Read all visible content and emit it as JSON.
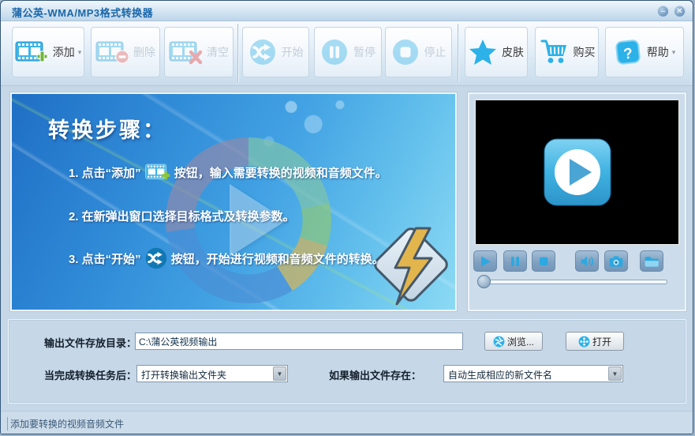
{
  "window": {
    "title": "蒲公英-WMA/MP3格式转换器"
  },
  "titlebar": {
    "minimize_glyph": "–",
    "close_glyph": "✕"
  },
  "toolbar": {
    "buttons": [
      {
        "label": "添加",
        "icon": "film-add-icon",
        "enabled": true,
        "dropdown": true
      },
      {
        "label": "删除",
        "icon": "film-delete-icon",
        "enabled": false,
        "dropdown": false
      },
      {
        "label": "清空",
        "icon": "film-clear-icon",
        "enabled": false,
        "dropdown": false
      },
      {
        "label": "开始",
        "icon": "start-shuffle-icon",
        "enabled": false,
        "dropdown": false
      },
      {
        "label": "暂停",
        "icon": "pause-circle-icon",
        "enabled": false,
        "dropdown": false
      },
      {
        "label": "停止",
        "icon": "stop-circle-icon",
        "enabled": false,
        "dropdown": false
      },
      {
        "label": "皮肤",
        "icon": "skin-star-icon",
        "enabled": true,
        "dropdown": false
      },
      {
        "label": "购买",
        "icon": "buy-cart-icon",
        "enabled": true,
        "dropdown": false
      },
      {
        "label": "帮助",
        "icon": "help-icon",
        "enabled": true,
        "dropdown": true
      }
    ],
    "dropdown_glyph": "▾"
  },
  "instructions": {
    "heading": "转换步骤：",
    "step1_pre": "1. 点击“添加”",
    "step1_post": "按钮，输入需要转换的视频和音频文件。",
    "step2": "2. 在新弹出窗口选择目标格式及转换参数。",
    "step3_pre": "3. 点击“开始”",
    "step3_post": "按钮，开始进行视频和音频文件的转换。"
  },
  "preview": {
    "player_icons": [
      "play-icon",
      "pause-icon",
      "stop-icon",
      "volume-icon",
      "snapshot-icon",
      "folder-icon"
    ],
    "progress": 0
  },
  "settings": {
    "dir_label": "输出文件存放目录：",
    "dir_value": "C:\\蒲公英视频输出",
    "browse_label": "浏览...",
    "open_label": "打开",
    "after_label": "当完成转换任务后：",
    "after_value": "打开转换输出文件夹",
    "exists_label": "如果输出文件存在：",
    "exists_value": "自动生成相应的新文件名"
  },
  "statusbar": {
    "text": "添加要转换的视频音频文件"
  },
  "colors": {
    "accent": "#2cb1e8",
    "title_text": "#1a66a8",
    "wallpaper_blue": "#2f89d6"
  }
}
